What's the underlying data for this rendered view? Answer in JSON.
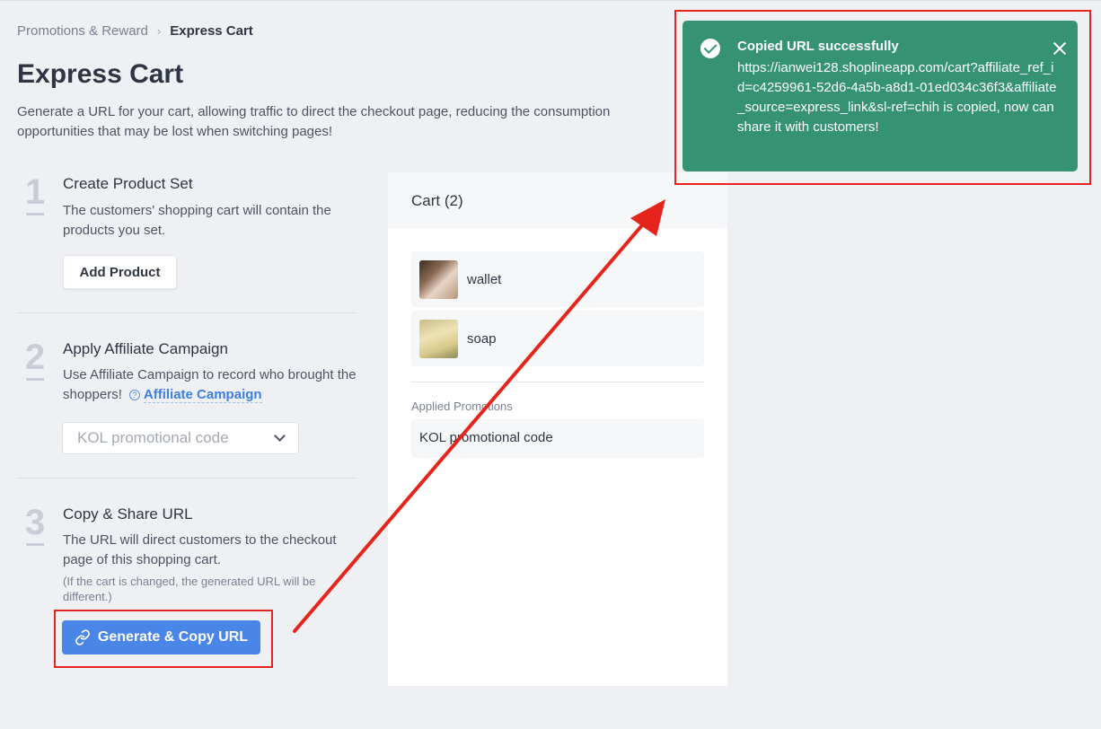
{
  "breadcrumb": {
    "parent": "Promotions & Reward",
    "separator": "›",
    "current": "Express Cart"
  },
  "page": {
    "title": "Express Cart",
    "description": "Generate a URL for your cart, allowing traffic to direct the checkout page, reducing the consumption opportunities that may be lost when switching pages!"
  },
  "steps": [
    {
      "number": "1",
      "title": "Create Product Set",
      "text": "The customers' shopping cart will contain the products you set.",
      "button": "Add Product"
    },
    {
      "number": "2",
      "title": "Apply Affiliate Campaign",
      "text": "Use Affiliate Campaign to record who brought the shoppers!",
      "help_symbol": "?",
      "link": "Affiliate Campaign",
      "select_value": "KOL promotional code"
    },
    {
      "number": "3",
      "title": "Copy & Share URL",
      "text": "The URL will direct customers to the checkout page of this shopping cart.",
      "note": "(If the cart is changed, the generated URL will be different.)",
      "button": "Generate & Copy URL"
    }
  ],
  "cart": {
    "title": "Cart (2)",
    "items": [
      {
        "name": "wallet",
        "icon": "wallet-thumbnail"
      },
      {
        "name": "soap",
        "icon": "soap-thumbnail"
      }
    ],
    "promotions_label": "Applied Promotions",
    "promotion": "KOL promotional code"
  },
  "toast": {
    "title": "Copied URL successfully",
    "message": "https://ianwei128.shoplineapp.com/cart?affiliate_ref_id=c4259961-52d6-4a5b-a8d1-01ed034c36f3&affiliate_source=express_link&sl-ref=chih is copied, now can share it with customers!",
    "status_color": "#359373"
  },
  "colors": {
    "primary": "#4a86e8",
    "annotation": "#e5251b",
    "background": "#eef0f3"
  }
}
